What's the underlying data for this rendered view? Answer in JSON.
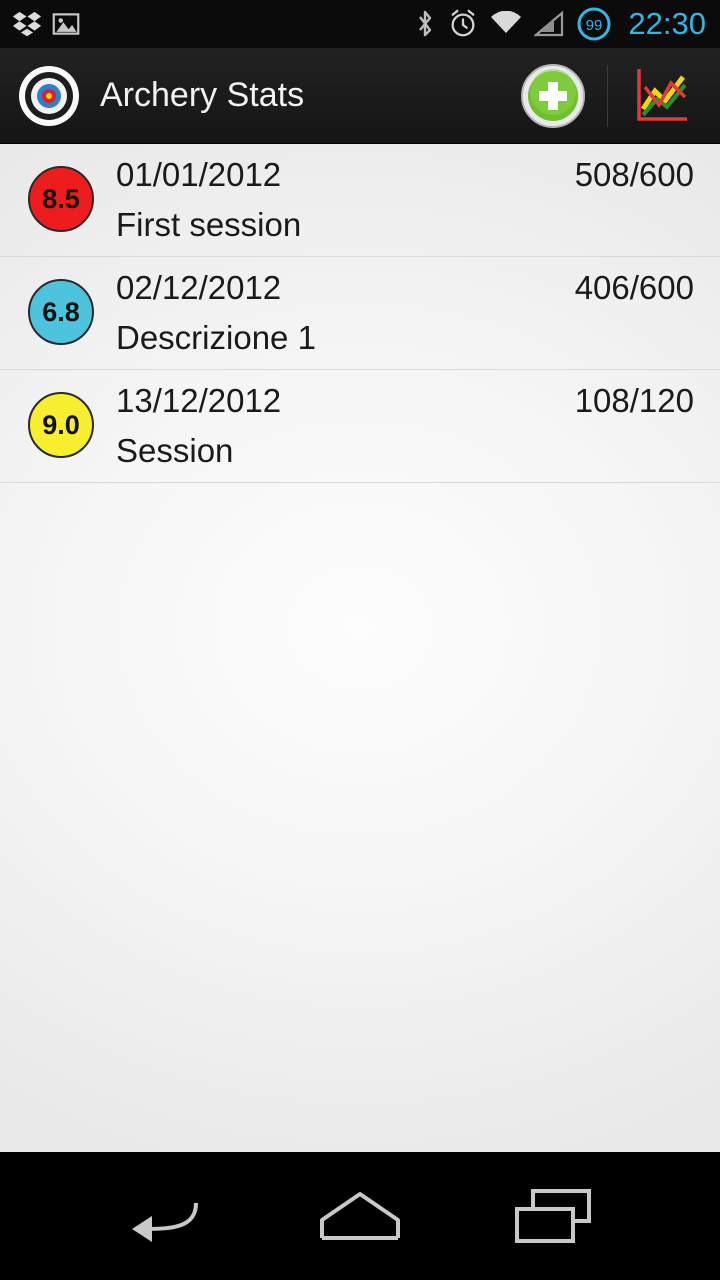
{
  "status_bar": {
    "icons": [
      "dropbox-icon",
      "gallery-icon",
      "bluetooth-icon",
      "alarm-icon",
      "wifi-icon",
      "signal-icon",
      "battery-icon"
    ],
    "battery_level": "99",
    "clock": "22:30",
    "clock_color": "#33b5e5"
  },
  "action_bar": {
    "logo": "target-icon",
    "title": "Archery Stats",
    "actions": [
      {
        "name": "add-session-button",
        "icon": "plus-icon",
        "label": ""
      },
      {
        "name": "statistics-button",
        "icon": "chart-icon",
        "label": ""
      }
    ]
  },
  "sessions": [
    {
      "average": "8.5",
      "badge_color": "#ee1c1c",
      "date": "01/01/2012",
      "description": "First session",
      "score": "508/600"
    },
    {
      "average": "6.8",
      "badge_color": "#4ec3dd",
      "date": "02/12/2012",
      "description": "Descrizione 1",
      "score": "406/600"
    },
    {
      "average": "9.0",
      "badge_color": "#f7ee2e",
      "date": "13/12/2012",
      "description": "Session",
      "score": "108/120"
    }
  ],
  "nav_bar": {
    "buttons": [
      {
        "name": "nav-back-button",
        "icon": "back-arrow-icon"
      },
      {
        "name": "nav-home-button",
        "icon": "home-icon"
      },
      {
        "name": "nav-recents-button",
        "icon": "recents-icon"
      }
    ]
  }
}
